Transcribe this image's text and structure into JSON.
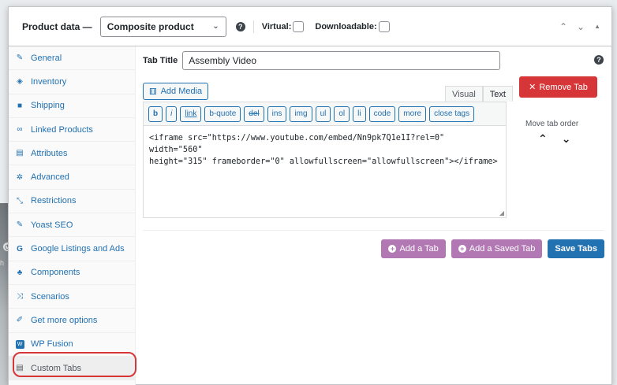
{
  "header": {
    "title": "Product data —",
    "product_type": "Composite product",
    "virtual_label": "Virtual:",
    "downloadable_label": "Downloadable:"
  },
  "sidebar": {
    "items": [
      {
        "label": "General",
        "icon": "wrench-icon"
      },
      {
        "label": "Inventory",
        "icon": "tag-icon"
      },
      {
        "label": "Shipping",
        "icon": "truck-icon"
      },
      {
        "label": "Linked Products",
        "icon": "link-icon"
      },
      {
        "label": "Attributes",
        "icon": "list-icon"
      },
      {
        "label": "Advanced",
        "icon": "gear-icon"
      },
      {
        "label": "Restrictions",
        "icon": "minimize-icon"
      },
      {
        "label": "Yoast SEO",
        "icon": "wrench-icon"
      },
      {
        "label": "Google Listings and Ads",
        "icon": "google-icon"
      },
      {
        "label": "Components",
        "icon": "components-icon"
      },
      {
        "label": "Scenarios",
        "icon": "shuffle-icon"
      },
      {
        "label": "Get more options",
        "icon": "plug-icon"
      },
      {
        "label": "WP Fusion",
        "icon": "wpfusion-icon"
      },
      {
        "label": "Custom Tabs",
        "icon": "tabs-icon"
      }
    ]
  },
  "main": {
    "tab_title_label": "Tab Title",
    "tab_title_value": "Assembly Video",
    "add_media_label": "Add Media",
    "editor_tabs": [
      "Visual",
      "Text"
    ],
    "quicktags": [
      "b",
      "i",
      "link",
      "b-quote",
      "del",
      "ins",
      "img",
      "ul",
      "ol",
      "li",
      "code",
      "more",
      "close tags"
    ],
    "editor_content": "<iframe src=\"https://www.youtube.com/embed/Nn9pk7Q1e1I?rel=0\" width=\"560\"\nheight=\"315\" frameborder=\"0\" allowfullscreen=\"allowfullscreen\"></iframe>",
    "remove_tab_label": "Remove Tab",
    "move_tab_order_label": "Move tab order",
    "add_tab_label": "Add a Tab",
    "add_saved_tab_label": "Add a Saved Tab",
    "save_tabs_label": "Save Tabs"
  },
  "colors": {
    "accent": "#2271b1",
    "danger": "#d63638",
    "purple": "#b178b4"
  }
}
